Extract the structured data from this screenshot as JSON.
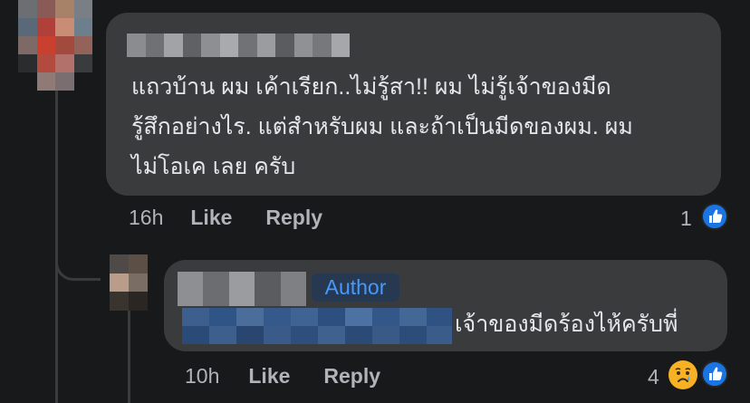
{
  "comment": {
    "text": "แถวบ้าน ผม เค้าเรียก..ไม่รู้สา!! ผม ไม่รู้เจ้าของมีด\nรู้สึกอย่างไร. แต่สำหรับผม และถ้าเป็นมีดของผม. ผม\nไม่โอเค เลย ครับ",
    "time": "16h",
    "like_label": "Like",
    "reply_label": "Reply",
    "reaction_count": "1",
    "reaction_icons": [
      "like-icon"
    ]
  },
  "reply": {
    "author_badge": "Author",
    "text": "เจ้าของมีดร้องไห้ครับพี่",
    "time": "10h",
    "like_label": "Like",
    "reply_label": "Reply",
    "reaction_count": "4",
    "reaction_icons": [
      "sad-icon",
      "like-icon"
    ]
  },
  "colors": {
    "background": "#18191a",
    "bubble": "#3a3b3c",
    "text_primary": "#e4e6eb",
    "text_secondary": "#b0b3b8",
    "accent_blue": "#1b74e4",
    "author_badge_bg": "#263951",
    "author_badge_text": "#4599ff",
    "sad_reaction": "#f7b125"
  }
}
